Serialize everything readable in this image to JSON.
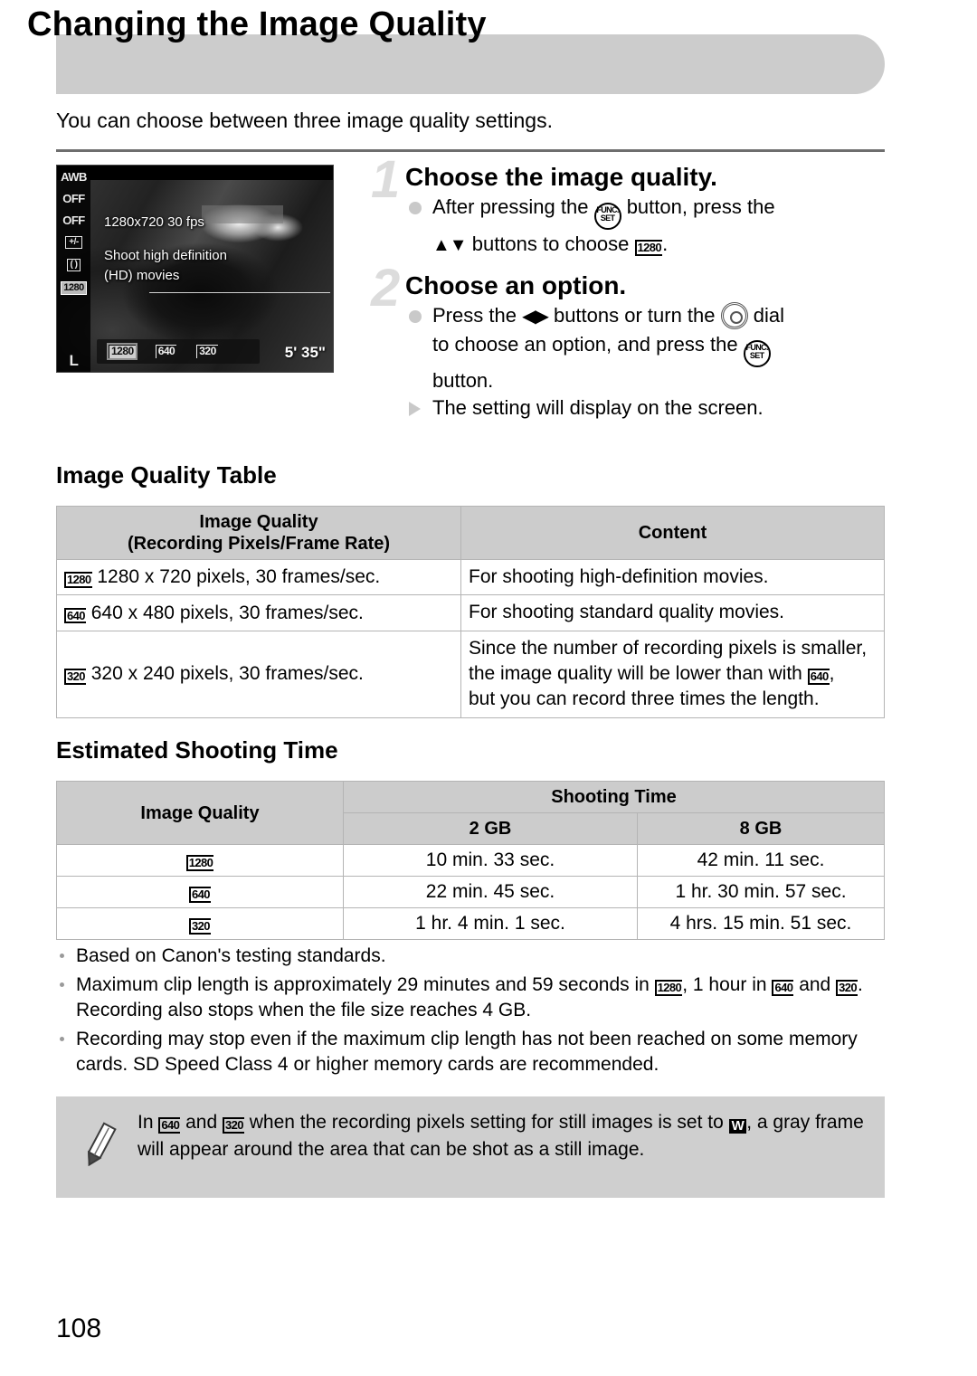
{
  "header": {
    "title": "Changing the Image Quality",
    "intro": "You can choose between three image quality settings."
  },
  "lcd": {
    "sidebar_icons": [
      "AWB",
      "OFF",
      "OFF",
      "EV",
      "METER",
      "1280",
      "L"
    ],
    "osd_resolution": "1280x720 30 fps",
    "osd_line1": "Shoot high definition",
    "osd_line2": "(HD) movies",
    "options": [
      "1280",
      "640",
      "320"
    ],
    "selected_option": "1280",
    "remaining_time": "5' 35\""
  },
  "steps": [
    {
      "number": "1",
      "heading": "Choose the image quality.",
      "line1_a": "After pressing the",
      "line1_b": "button, press the",
      "line2_a": "buttons to choose",
      "line2_icon": "1280",
      "line2_b": "."
    },
    {
      "number": "2",
      "heading": "Choose an option.",
      "line1_a": "Press the",
      "line1_b": "buttons or turn the",
      "line1_c": "dial",
      "line2_a": "to choose an option, and press the",
      "line3": "button.",
      "result": "The setting will display on the screen."
    }
  ],
  "quality_section": {
    "heading": "Image Quality Table",
    "columns": [
      "Image Quality\n(Recording Pixels/Frame Rate)",
      "Content"
    ],
    "col1_line1": "Image Quality",
    "col1_line2": "(Recording Pixels/Frame Rate)",
    "col2": "Content",
    "rows": [
      {
        "icon": "1280",
        "spec": "1280 x 720 pixels, 30 frames/sec.",
        "content": "For shooting high-definition movies."
      },
      {
        "icon": "640",
        "spec": "640 x 480 pixels, 30 frames/sec.",
        "content": "For shooting standard quality movies."
      },
      {
        "icon": "320",
        "spec": "320 x 240 pixels, 30 frames/sec.",
        "content_a": "Since the number of recording pixels is smaller,",
        "content_b": "the image quality will be lower than with",
        "content_icon": "640",
        "content_c": ",",
        "content_d": "but you can record three times the length."
      }
    ]
  },
  "time_section": {
    "heading": "Estimated Shooting Time",
    "col_quality": "Image Quality",
    "col_time": "Shooting Time",
    "col_2gb": "2 GB",
    "col_8gb": "8 GB",
    "rows": [
      {
        "icon": "1280",
        "t2gb": "10 min. 33 sec.",
        "t8gb": "42 min. 11 sec."
      },
      {
        "icon": "640",
        "t2gb": "22 min. 45 sec.",
        "t8gb": "1 hr. 30 min. 57 sec."
      },
      {
        "icon": "320",
        "t2gb": "1 hr. 4 min. 1 sec.",
        "t8gb": "4 hrs. 15 min. 51 sec."
      }
    ]
  },
  "notes": {
    "note1": "Based on Canon's testing standards.",
    "note2_a": "Maximum clip length is approximately 29 minutes and 59 seconds in",
    "note2_icon1": "1280",
    "note2_b": ", 1 hour in",
    "note2_icon2": "640",
    "note2_c": "and",
    "note2_icon3": "320",
    "note2_d": ". Recording also stops when the file size reaches 4 GB.",
    "note3_a": "Recording may stop even if the maximum clip length has not been reached on some",
    "note3_b": "memory cards. SD Speed Class 4 or higher memory cards are recommended."
  },
  "tip": {
    "a": "In",
    "icon1": "640",
    "b": "and",
    "icon2": "320",
    "c": "when the recording pixels setting for still images is set to",
    "icon3": "W",
    "d": ", a gray frame will appear around the area that can be shot as a still",
    "e": "image."
  },
  "page_number": "108"
}
